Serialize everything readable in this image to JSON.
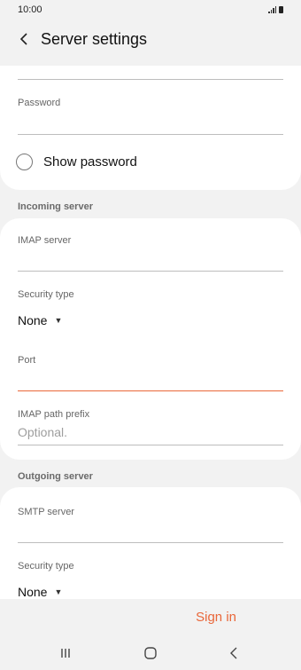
{
  "status_bar": {
    "time": "10:00"
  },
  "app_bar": {
    "title": "Server settings"
  },
  "account": {
    "password_label": "Password",
    "show_password_label": "Show password"
  },
  "incoming": {
    "header": "Incoming server",
    "imap_server_label": "IMAP server",
    "security_type_label": "Security type",
    "security_type_value": "None",
    "port_label": "Port",
    "imap_path_prefix_label": "IMAP path prefix",
    "imap_path_prefix_placeholder": "Optional."
  },
  "outgoing": {
    "header": "Outgoing server",
    "smtp_server_label": "SMTP server",
    "security_type_label": "Security type",
    "security_type_value": "None"
  },
  "actions": {
    "sign_in_label": "Sign in"
  },
  "colors": {
    "accent": "#e9673a",
    "background": "#f2f2f2",
    "card": "#ffffff"
  },
  "icons": [
    "back-arrow-icon",
    "signal-icon",
    "battery-icon",
    "caret-down-icon",
    "recents-icon",
    "home-icon",
    "nav-back-icon"
  ]
}
